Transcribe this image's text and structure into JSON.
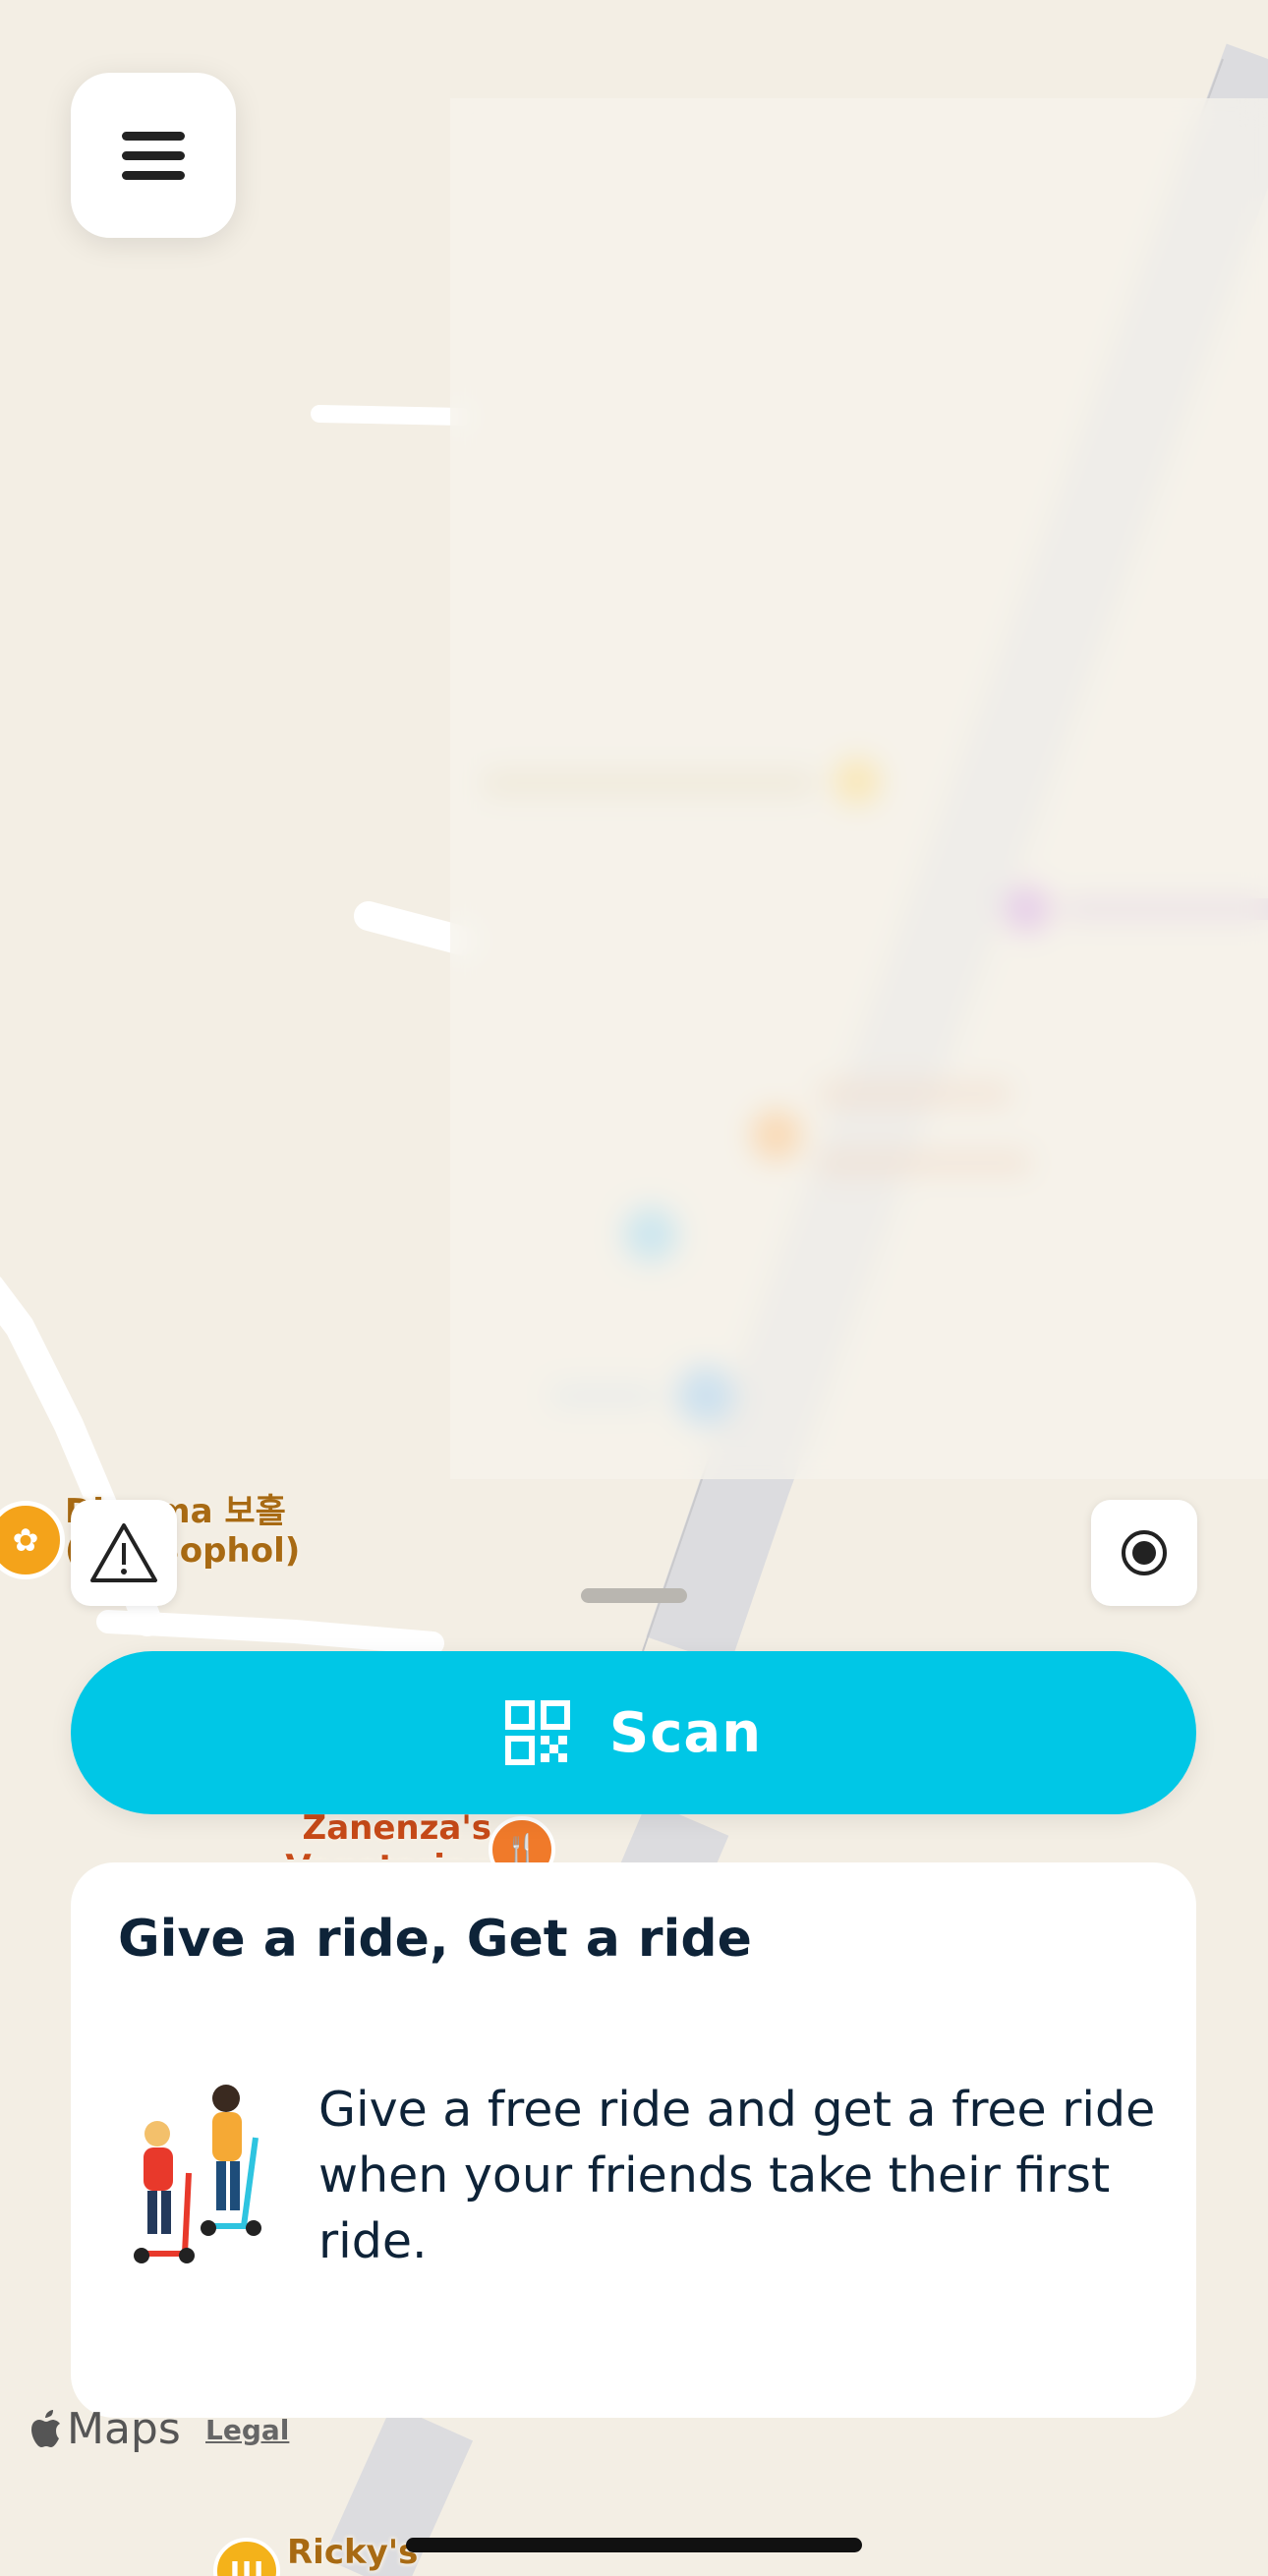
{
  "menu": {
    "icon": "hamburger-menu-icon"
  },
  "map": {
    "pois": [
      {
        "name": "poi-temple",
        "label": "Dharma 보홀(the Bophol)",
        "color": "#a86a13",
        "icon": "lotus-icon"
      },
      {
        "name": "poi-restaurant-zanenza",
        "label": "Zanenza's Vegetarian Bistro",
        "color": "#c74a18",
        "icon": "fork-knife-icon"
      },
      {
        "name": "poi-rickys",
        "label": "Ricky's",
        "color": "#a86a13",
        "icon": "food-icon"
      }
    ]
  },
  "controls": {
    "report_icon": "warning-triangle-icon",
    "locate_icon": "my-location-icon"
  },
  "scan": {
    "label": "Scan",
    "icon": "qr-code-icon"
  },
  "promo": {
    "title": "Give a ride, Get a ride",
    "body": "Give a free ride and get a free ride when your friends take their first ride.",
    "illustration": "scooter-riders-illustration"
  },
  "footer": {
    "maps_label": "Maps",
    "legal_label": "Legal",
    "apple_icon": "apple-logo-icon"
  },
  "colors": {
    "accent": "#00c7e6",
    "text_dark": "#0e2338",
    "map_bg": "#f3eee4"
  }
}
